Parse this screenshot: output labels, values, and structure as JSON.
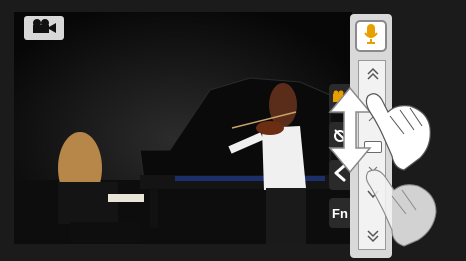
{
  "camera": {
    "mode_icon": "video-camera-icon",
    "side_controls": [
      {
        "icon": "movie-mode-icon"
      },
      {
        "icon": "effect-icon"
      },
      {
        "icon": "back-chevron-icon"
      },
      {
        "label": "Fn"
      }
    ],
    "zoom_panel": {
      "mic_icon": "microphone-icon",
      "up_icons": [
        "double-chevron-up-icon",
        "chevron-up-icon",
        "small-chevron-up-icon"
      ],
      "down_icons": [
        "small-chevron-down-icon",
        "chevron-down-icon",
        "double-chevron-down-icon"
      ],
      "level": 0.45
    },
    "gesture": {
      "icon": "swipe-up-down-gesture-icon"
    },
    "colors": {
      "accent": "#e8a000",
      "panel": "#d9d9d9"
    }
  }
}
